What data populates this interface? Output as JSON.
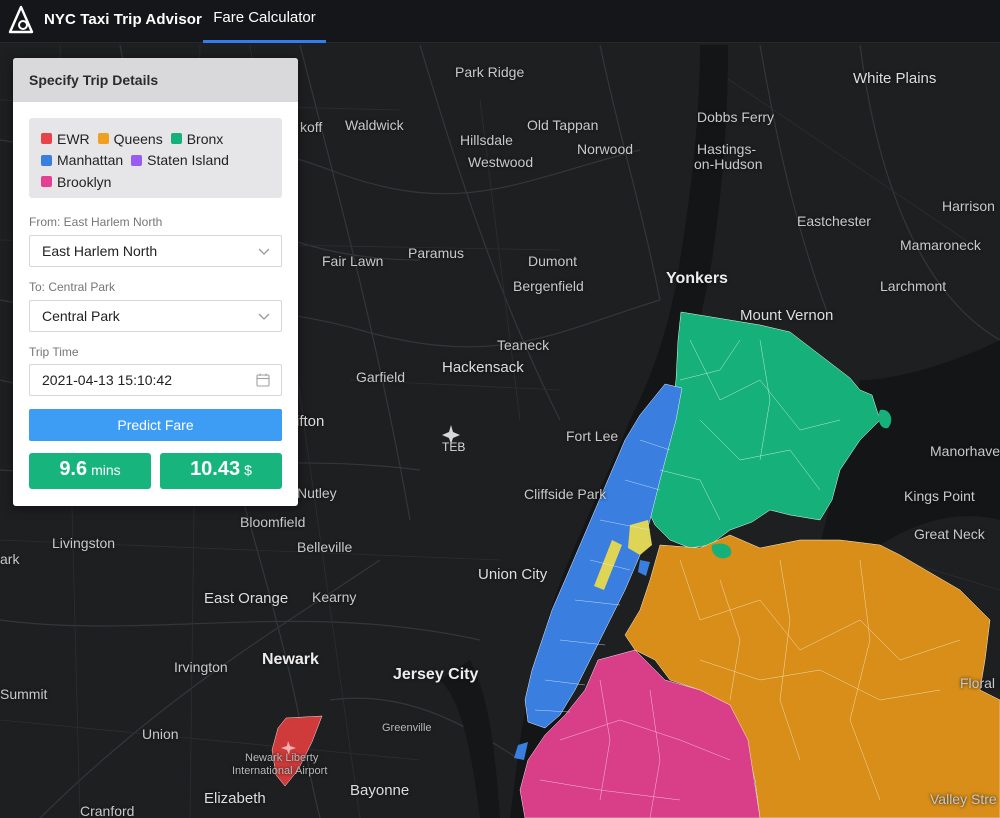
{
  "app": {
    "title": "NYC Taxi Trip Advisor",
    "nav_tab": "Fare Calculator"
  },
  "panel": {
    "title": "Specify Trip Details",
    "legend": [
      {
        "label": "EWR",
        "color": "#e8434b"
      },
      {
        "label": "Queens",
        "color": "#f0a020"
      },
      {
        "label": "Bronx",
        "color": "#16b07a"
      },
      {
        "label": "Manhattan",
        "color": "#3a7fe0"
      },
      {
        "label": "Staten Island",
        "color": "#9a5cf0"
      },
      {
        "label": "Brooklyn",
        "color": "#e43f92"
      }
    ],
    "from_label": "From: East Harlem North",
    "from_value": "East Harlem North",
    "to_label": "To: Central Park",
    "to_value": "Central Park",
    "time_label": "Trip Time",
    "time_value": "2021-04-13 15:10:42",
    "predict_label": "Predict Fare",
    "duration_value": "9.6",
    "duration_unit": "mins",
    "fare_value": "10.43",
    "fare_unit": "$"
  },
  "map": {
    "places": [
      {
        "name": "Park Ridge",
        "cls": ""
      },
      {
        "name": "White Plains",
        "cls": "med"
      },
      {
        "name": "Waldwick",
        "cls": ""
      },
      {
        "name": "Old Tappan",
        "cls": ""
      },
      {
        "name": "Dobbs Ferry",
        "cls": ""
      },
      {
        "name": "Hillsdale",
        "cls": ""
      },
      {
        "name": "Westwood",
        "cls": ""
      },
      {
        "name": "Norwood",
        "cls": ""
      },
      {
        "name": "Hastings-",
        "cls": ""
      },
      {
        "name": "on-Hudson",
        "cls": ""
      },
      {
        "name": "Harrison",
        "cls": ""
      },
      {
        "name": "Eastchester",
        "cls": ""
      },
      {
        "name": "Paramus",
        "cls": ""
      },
      {
        "name": "Mamaroneck",
        "cls": ""
      },
      {
        "name": "Fair Lawn",
        "cls": ""
      },
      {
        "name": "Dumont",
        "cls": ""
      },
      {
        "name": "Bergenfield",
        "cls": ""
      },
      {
        "name": "Yonkers",
        "cls": "big"
      },
      {
        "name": "Larchmont",
        "cls": ""
      },
      {
        "name": "Mount Vernon",
        "cls": "med"
      },
      {
        "name": "Teaneck",
        "cls": ""
      },
      {
        "name": "Hackensack",
        "cls": "med"
      },
      {
        "name": "Garfield",
        "cls": ""
      },
      {
        "name": "Fort Lee",
        "cls": ""
      },
      {
        "name": "Manorhaven",
        "cls": ""
      },
      {
        "name": "Cliffside Park",
        "cls": ""
      },
      {
        "name": "Kings Point",
        "cls": ""
      },
      {
        "name": "Nutley",
        "cls": ""
      },
      {
        "name": "Bloomfield",
        "cls": ""
      },
      {
        "name": "Great Neck",
        "cls": ""
      },
      {
        "name": "Livingston",
        "cls": ""
      },
      {
        "name": "Belleville",
        "cls": ""
      },
      {
        "name": "Union City",
        "cls": "med"
      },
      {
        "name": "East Orange",
        "cls": "med"
      },
      {
        "name": "Kearny",
        "cls": ""
      },
      {
        "name": "Newark",
        "cls": "big"
      },
      {
        "name": "Irvington",
        "cls": ""
      },
      {
        "name": "Jersey City",
        "cls": "big"
      },
      {
        "name": "Summit",
        "cls": ""
      },
      {
        "name": "Union",
        "cls": ""
      },
      {
        "name": "Greenville",
        "cls": "small"
      },
      {
        "name": "Bayonne",
        "cls": "med"
      },
      {
        "name": "Elizabeth",
        "cls": "med"
      },
      {
        "name": "Cranford",
        "cls": ""
      },
      {
        "name": "Valley Stre",
        "cls": ""
      },
      {
        "name": "Floral Pa",
        "cls": ""
      },
      {
        "name": "koff",
        "cls": ""
      },
      {
        "name": "ifton",
        "cls": "med"
      },
      {
        "name": "ark",
        "cls": ""
      },
      {
        "name": "Newark Liberty",
        "cls": "small"
      },
      {
        "name": "International Airport",
        "cls": "small"
      }
    ],
    "airport_label": "TEB"
  }
}
